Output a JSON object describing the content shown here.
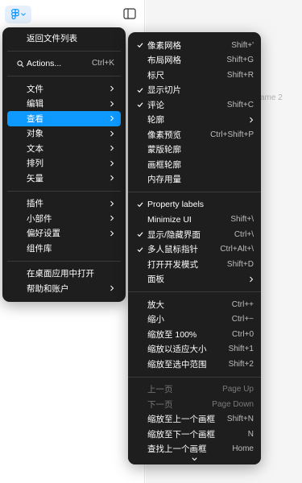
{
  "canvas": {
    "frame_label": "ame 2"
  },
  "colors": {
    "menu_bg": "#1e1e1e",
    "accent": "#0d99ff",
    "shortcut": "#bdbdbd"
  },
  "icons": {
    "logo": "figma-logo-icon",
    "sidebar": "sidebar-toggle-icon",
    "search": "search-icon",
    "scroll": "chevron-down-icon"
  },
  "main_menu": {
    "back": "返回文件列表",
    "actions": {
      "label": "Actions...",
      "shortcut": "Ctrl+K"
    },
    "file": "文件",
    "edit": "编辑",
    "view": "查看",
    "object": "对象",
    "text": "文本",
    "arrange": "排列",
    "vector": "矢量",
    "plugins": "插件",
    "widgets": "小部件",
    "preferences": "偏好设置",
    "libraries": "组件库",
    "open_desktop": "在桌面应用中打开",
    "help": "帮助和账户"
  },
  "view_menu": {
    "pixel_grid": {
      "label": "像素网格",
      "shortcut": "Shift+'"
    },
    "layout_grid": {
      "label": "布局网格",
      "shortcut": "Shift+G"
    },
    "rulers": {
      "label": "标尺",
      "shortcut": "Shift+R"
    },
    "show_slices": {
      "label": "显示切片",
      "shortcut": ""
    },
    "comments": {
      "label": "评论",
      "shortcut": "Shift+C"
    },
    "outlines": {
      "label": "轮廓"
    },
    "pixel_preview": {
      "label": "像素预览",
      "shortcut": "Ctrl+Shift+P"
    },
    "mask_outlines": {
      "label": "蒙版轮廓"
    },
    "frame_outlines": {
      "label": "画框轮廓"
    },
    "memory_usage": {
      "label": "内存用量"
    },
    "property_labels": {
      "label": "Property labels"
    },
    "minimize_ui": {
      "label": "Minimize UI",
      "shortcut": "Shift+\\"
    },
    "show_hide_ui": {
      "label": "显示/隐藏界面",
      "shortcut": "Ctrl+\\"
    },
    "multiplayer_cursors": {
      "label": "多人鼠标指针",
      "shortcut": "Ctrl+Alt+\\"
    },
    "dev_mode": {
      "label": "打开开发模式",
      "shortcut": "Shift+D"
    },
    "panels": {
      "label": "面板"
    },
    "zoom_in": {
      "label": "放大",
      "shortcut": "Ctrl++"
    },
    "zoom_out": {
      "label": "缩小",
      "shortcut": "Ctrl+−"
    },
    "zoom_100": {
      "label": "缩放至 100%",
      "shortcut": "Ctrl+0"
    },
    "zoom_fit": {
      "label": "缩放以适应大小",
      "shortcut": "Shift+1"
    },
    "zoom_selection": {
      "label": "缩放至选中范围",
      "shortcut": "Shift+2"
    },
    "page_up": {
      "label": "上一页",
      "shortcut": "Page Up"
    },
    "page_down": {
      "label": "下一页",
      "shortcut": "Page Down"
    },
    "zoom_prev_frame": {
      "label": "缩放至上一个画框",
      "shortcut": "Shift+N"
    },
    "zoom_next_frame": {
      "label": "缩放至下一个画框",
      "shortcut": "N"
    },
    "find_prev_frame": {
      "label": "查找上一个画框",
      "shortcut": "Home"
    }
  }
}
